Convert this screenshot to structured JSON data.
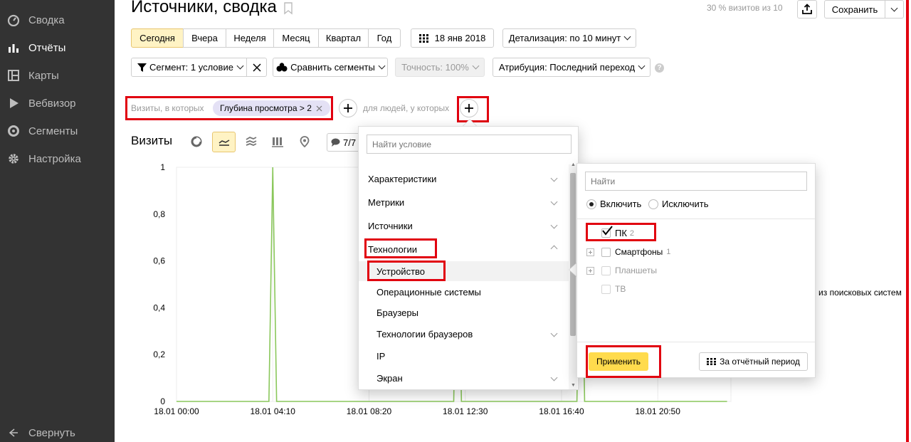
{
  "sidebar": {
    "items": [
      {
        "label": "Сводка",
        "icon": "dashboard-icon",
        "active": false
      },
      {
        "label": "Отчёты",
        "icon": "bar-chart-icon",
        "active": true
      },
      {
        "label": "Карты",
        "icon": "map-icon",
        "active": false
      },
      {
        "label": "Вебвизор",
        "icon": "play-icon",
        "active": false
      },
      {
        "label": "Сегменты",
        "icon": "segments-icon",
        "active": false
      },
      {
        "label": "Настройка",
        "icon": "gear-icon",
        "active": false
      }
    ],
    "collapse_label": "Свернуть"
  },
  "header": {
    "title": "Источники, сводка",
    "sampling": "30 % визитов из 10",
    "save_label": "Сохранить"
  },
  "periods": [
    "Сегодня",
    "Вчера",
    "Неделя",
    "Месяц",
    "Квартал",
    "Год"
  ],
  "active_period": "Сегодня",
  "date_label": "18 янв 2018",
  "detail_label": "Детализация: по 10 минут",
  "toolbar2": {
    "segment_label": "Сегмент: 1 условие",
    "compare_label": "Сравнить сегменты",
    "accuracy_label": "Точность: 100%",
    "attribution_label": "Атрибуция: Последний переход"
  },
  "filter": {
    "prefix": "Визиты, в которых",
    "chip": "Глубина просмотра > 2",
    "people_label": "для людей, у которых"
  },
  "chart_header": {
    "title": "Визиты",
    "counter": "7/7"
  },
  "conditions": {
    "search_placeholder": "Найти условие",
    "groups": [
      {
        "label": "Характеристики",
        "expanded": false
      },
      {
        "label": "Метрики",
        "expanded": false
      },
      {
        "label": "Источники",
        "expanded": false
      },
      {
        "label": "Технологии",
        "expanded": true
      }
    ],
    "subitems": [
      {
        "label": "Устройство",
        "selected": true,
        "has_children": false
      },
      {
        "label": "Операционные системы",
        "has_children": false
      },
      {
        "label": "Браузеры",
        "has_children": false
      },
      {
        "label": "Технологии браузеров",
        "has_children": true
      },
      {
        "label": "IP",
        "has_children": false
      },
      {
        "label": "Экран",
        "has_children": true
      }
    ]
  },
  "values_panel": {
    "search_placeholder": "Найти",
    "include_label": "Включить",
    "exclude_label": "Исключить",
    "options": [
      {
        "label": "ПК",
        "count": "2",
        "checked": true,
        "expandable": false,
        "enabled": true
      },
      {
        "label": "Смартфоны",
        "count": "1",
        "checked": false,
        "expandable": true,
        "enabled": true
      },
      {
        "label": "Планшеты",
        "count": "",
        "checked": false,
        "expandable": true,
        "enabled": false
      },
      {
        "label": "ТВ",
        "count": "",
        "checked": false,
        "expandable": false,
        "enabled": false
      }
    ],
    "apply_label": "Применить",
    "period_label": "За отчётный период"
  },
  "side_text": "и из поисковых систем",
  "colors": {
    "line": "#8ac75b",
    "accent": "#ffdb4d",
    "highlight": "#e1000f",
    "sidebar": "#333333"
  },
  "chart_data": {
    "type": "line",
    "ylim": [
      0,
      1
    ],
    "yticks": [
      "0",
      "0,2",
      "0,4",
      "0,6",
      "0,8",
      "1"
    ],
    "xticks": [
      "18.01 00:00",
      "18.01 04:10",
      "18.01 08:20",
      "18.01 12:30",
      "18.01 16:40",
      "18.01 20:50"
    ],
    "series": [
      {
        "x": [
          "18.01 00:00",
          "18.01 04:00",
          "18.01 04:10",
          "18.01 04:20",
          "18.01 12:00",
          "18.01 12:10",
          "18.01 12:20",
          "18.01 17:20",
          "18.01 17:30",
          "18.01 17:40",
          "18.01 23:50"
        ],
        "values": [
          0,
          0,
          1,
          0,
          0,
          1,
          0,
          0,
          1,
          0,
          0
        ]
      }
    ]
  }
}
